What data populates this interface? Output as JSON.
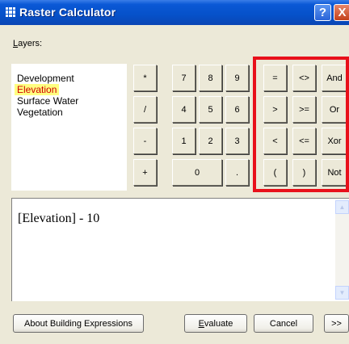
{
  "window": {
    "title": "Raster Calculator",
    "help_label": "?",
    "close_label": "X"
  },
  "layers": {
    "label_underlined": "L",
    "label_rest": "ayers:",
    "items": [
      {
        "label": "Development",
        "selected": false
      },
      {
        "label": "Elevation",
        "selected": true
      },
      {
        "label": "Surface Water",
        "selected": false
      },
      {
        "label": "Vegetation",
        "selected": false
      }
    ]
  },
  "keypad": {
    "ops": [
      "*",
      "/",
      "-",
      "+"
    ],
    "digits": [
      "7",
      "8",
      "9",
      "4",
      "5",
      "6",
      "1",
      "2",
      "3"
    ],
    "zero": "0",
    "dot": ".",
    "comparison": [
      "=",
      "<>",
      "And",
      ">",
      ">=",
      "Or",
      "<",
      "<=",
      "Xor",
      "(",
      ")",
      "Not"
    ]
  },
  "expression": {
    "value": "[Elevation] - 10"
  },
  "buttons": {
    "about": "About Building Expressions",
    "evaluate_underlined": "E",
    "evaluate_rest": "valuate",
    "cancel": "Cancel",
    "more": ">>"
  }
}
